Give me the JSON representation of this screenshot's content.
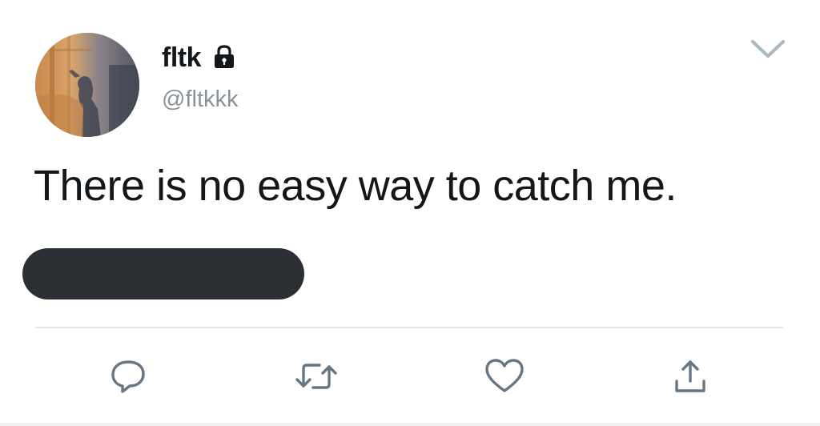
{
  "user": {
    "display_name": "fltk",
    "handle": "@fltkkk",
    "protected_icon": "lock-icon",
    "avatar": "profile-photo"
  },
  "tweet": {
    "text": "There is no easy way to catch me.",
    "redacted": true
  },
  "actions": [
    {
      "name": "reply",
      "icon": "reply-icon"
    },
    {
      "name": "retweet",
      "icon": "retweet-icon"
    },
    {
      "name": "like",
      "icon": "heart-icon"
    },
    {
      "name": "share",
      "icon": "share-icon"
    }
  ],
  "menu": {
    "icon": "chevron-down-icon"
  },
  "colors": {
    "text": "#14171a",
    "secondary": "#8a9298",
    "icon": "#657786",
    "divider": "#e1e8ed",
    "redaction": "#2b2f33"
  }
}
